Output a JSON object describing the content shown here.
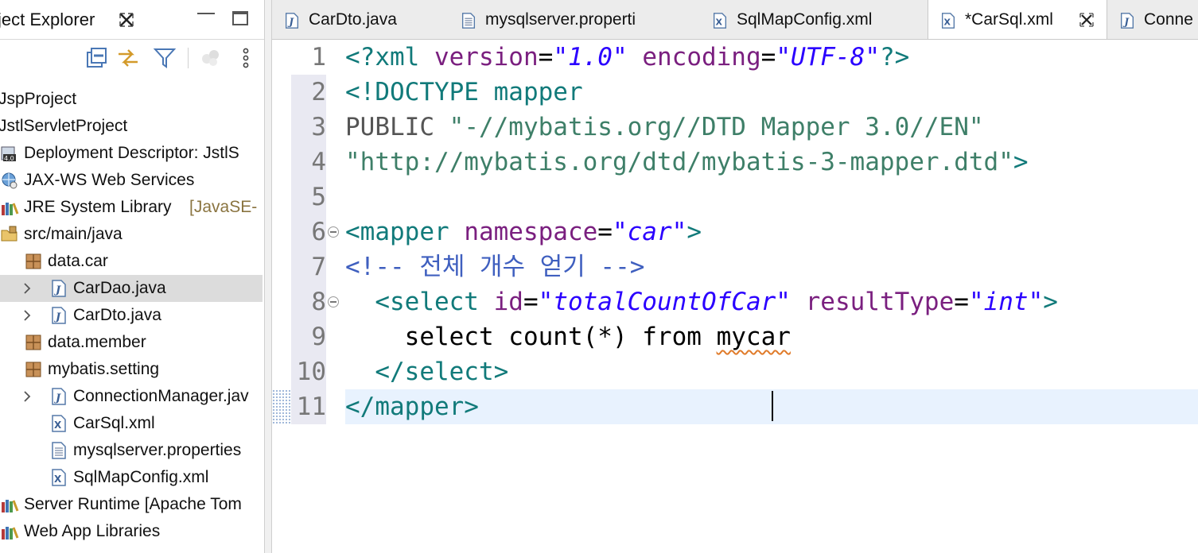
{
  "explorer": {
    "title": "ject Explorer",
    "tree": [
      {
        "label": "JspProject",
        "icon": "project-icon",
        "has_arrow": false
      },
      {
        "label": "JstlServletProject",
        "icon": "project-icon",
        "has_arrow": false
      },
      {
        "label": "Deployment Descriptor: JstlS",
        "icon": "deployment-descriptor-icon",
        "has_arrow": false
      },
      {
        "label": "JAX-WS Web Services",
        "icon": "web-services-icon",
        "has_arrow": false
      },
      {
        "label": "JRE System Library",
        "decor": "[JavaSE-",
        "icon": "library-icon",
        "has_arrow": false
      },
      {
        "label": "src/main/java",
        "icon": "source-folder-icon",
        "has_arrow": false
      },
      {
        "label": "data.car",
        "icon": "package-icon",
        "has_arrow": false
      },
      {
        "label": "CarDao.java",
        "icon": "java-file-icon",
        "has_arrow": true,
        "selected": true
      },
      {
        "label": "CarDto.java",
        "icon": "java-file-icon",
        "has_arrow": true
      },
      {
        "label": "data.member",
        "icon": "package-icon",
        "has_arrow": false
      },
      {
        "label": "mybatis.setting",
        "icon": "package-icon",
        "has_arrow": false
      },
      {
        "label": "ConnectionManager.jav",
        "icon": "java-file-icon",
        "has_arrow": true
      },
      {
        "label": "CarSql.xml",
        "icon": "xml-file-icon",
        "has_arrow": false
      },
      {
        "label": "mysqlserver.properties",
        "icon": "properties-file-icon",
        "has_arrow": false
      },
      {
        "label": "SqlMapConfig.xml",
        "icon": "xml-file-icon",
        "has_arrow": false
      },
      {
        "label": "Server Runtime [Apache Tom",
        "icon": "library-icon",
        "has_arrow": false
      },
      {
        "label": "Web App Libraries",
        "icon": "library-icon",
        "has_arrow": false
      }
    ]
  },
  "editor": {
    "tabs": [
      {
        "label": "CarDto.java",
        "icon": "java-file-icon",
        "active": false
      },
      {
        "label": "mysqlserver.properti",
        "icon": "properties-file-icon",
        "active": false
      },
      {
        "label": "SqlMapConfig.xml",
        "icon": "xml-file-icon",
        "active": false
      },
      {
        "label": "*CarSql.xml",
        "icon": "xml-file-icon",
        "active": true
      },
      {
        "label": "Conne",
        "icon": "java-file-icon",
        "active": false
      }
    ],
    "lines": [
      {
        "number": "1",
        "fold": false,
        "tokens": [
          [
            "tag",
            "<?xml "
          ],
          [
            "attr",
            "version"
          ],
          [
            "text",
            "="
          ],
          [
            "dq",
            "\""
          ],
          [
            "str",
            "1.0"
          ],
          [
            "dq",
            "\""
          ],
          [
            "text",
            " "
          ],
          [
            "attr",
            "encoding"
          ],
          [
            "text",
            "="
          ],
          [
            "dq",
            "\""
          ],
          [
            "str",
            "UTF-8"
          ],
          [
            "dq",
            "\""
          ],
          [
            "tag",
            "?>"
          ]
        ]
      },
      {
        "number": "2",
        "fold": false,
        "tokens": [
          [
            "tag",
            "<!DOCTYPE mapper"
          ]
        ]
      },
      {
        "number": "3",
        "fold": false,
        "tokens": [
          [
            "gray",
            "PUBLIC "
          ],
          [
            "pubid",
            "\"-//mybatis.org//DTD Mapper 3.0//EN\""
          ]
        ]
      },
      {
        "number": "4",
        "fold": false,
        "tokens": [
          [
            "pubid",
            "\"http://mybatis.org/dtd/mybatis-3-mapper.dtd\""
          ],
          [
            "tag",
            ">"
          ]
        ]
      },
      {
        "number": "5",
        "fold": false,
        "tokens": []
      },
      {
        "number": "6",
        "fold": true,
        "tokens": [
          [
            "tag",
            "<mapper "
          ],
          [
            "attr",
            "namespace"
          ],
          [
            "text",
            "="
          ],
          [
            "dq",
            "\""
          ],
          [
            "str",
            "car"
          ],
          [
            "dq",
            "\""
          ],
          [
            "tag",
            ">"
          ]
        ]
      },
      {
        "number": "7",
        "fold": false,
        "tokens": [
          [
            "comment",
            "<!-- 전체 개수 얻기 -->"
          ]
        ]
      },
      {
        "number": "8",
        "fold": true,
        "tokens": [
          [
            "text",
            "  "
          ],
          [
            "tag",
            "<select "
          ],
          [
            "attr",
            "id"
          ],
          [
            "text",
            "="
          ],
          [
            "dq",
            "\""
          ],
          [
            "str",
            "totalCountOfCar"
          ],
          [
            "dq",
            "\""
          ],
          [
            "text",
            " "
          ],
          [
            "attr",
            "resultType"
          ],
          [
            "text",
            "="
          ],
          [
            "dq",
            "\""
          ],
          [
            "str",
            "int"
          ],
          [
            "dq",
            "\""
          ],
          [
            "tag",
            ">"
          ]
        ]
      },
      {
        "number": "9",
        "fold": false,
        "tokens": [
          [
            "text",
            "    select count(*) from "
          ],
          [
            "squiggle",
            "mycar"
          ]
        ]
      },
      {
        "number": "10",
        "fold": false,
        "tokens": [
          [
            "text",
            "  "
          ],
          [
            "tag",
            "</select>"
          ]
        ]
      },
      {
        "number": "11",
        "fold": false,
        "tokens": [
          [
            "tag",
            "</mapper>"
          ]
        ]
      }
    ]
  }
}
